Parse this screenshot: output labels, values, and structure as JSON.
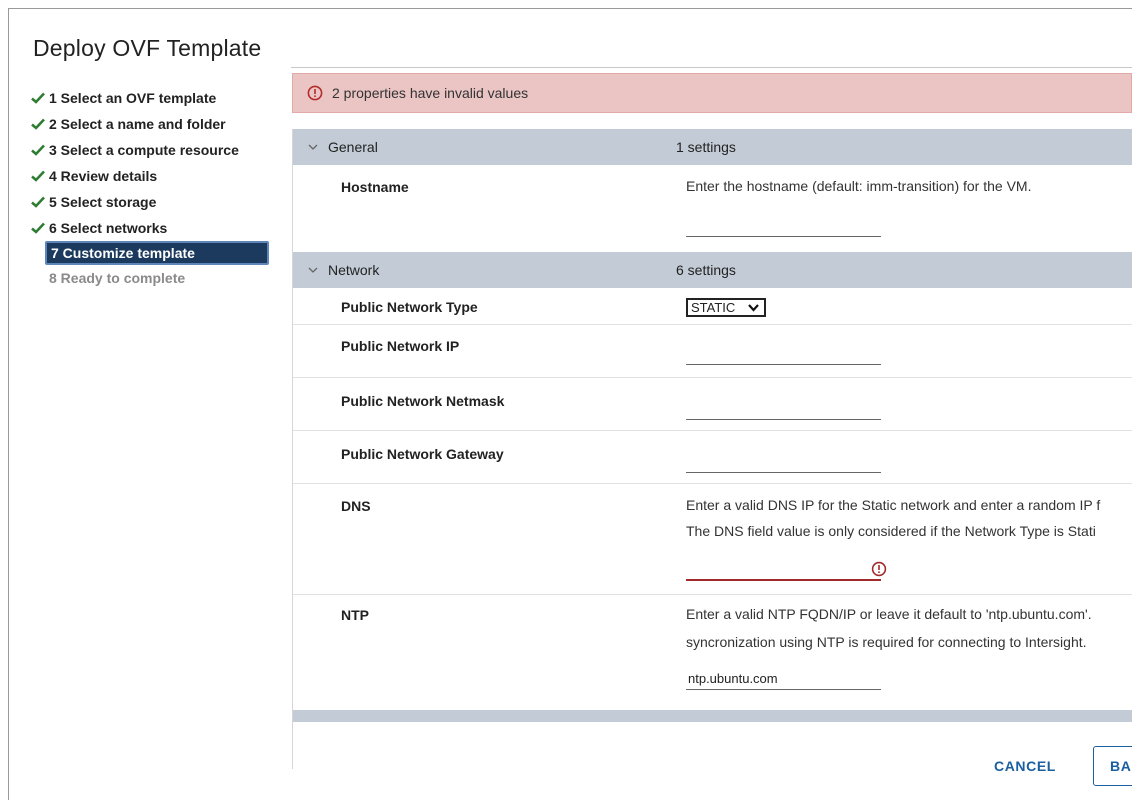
{
  "dialog": {
    "title": "Deploy OVF Template"
  },
  "steps": [
    {
      "label": "1 Select an OVF template",
      "state": "done"
    },
    {
      "label": "2 Select a name and folder",
      "state": "done"
    },
    {
      "label": "3 Select a compute resource",
      "state": "done"
    },
    {
      "label": "4 Review details",
      "state": "done"
    },
    {
      "label": "5 Select storage",
      "state": "done"
    },
    {
      "label": "6 Select networks",
      "state": "done"
    },
    {
      "label": "7 Customize template",
      "state": "active"
    },
    {
      "label": "8 Ready to complete",
      "state": "disabled"
    }
  ],
  "alert": {
    "text": "2 properties have invalid values",
    "icon": "error-circle-icon"
  },
  "general": {
    "name": "General",
    "count": "1 settings",
    "hostname": {
      "label": "Hostname",
      "description": "Enter the hostname (default: imm-transition) for the VM.",
      "value": ""
    }
  },
  "network": {
    "name": "Network",
    "count": "6 settings",
    "public_type": {
      "label": "Public Network Type",
      "value": "STATIC"
    },
    "public_ip": {
      "label": "Public Network IP",
      "value": ""
    },
    "public_netmask": {
      "label": "Public Network Netmask",
      "value": ""
    },
    "public_gateway": {
      "label": "Public Network Gateway",
      "value": ""
    },
    "dns": {
      "label": "DNS",
      "desc_line1": "Enter a valid DNS IP for the Static network and enter a random IP f",
      "desc_line2": "The DNS field value is only considered if the Network Type is Stati",
      "value": ""
    },
    "ntp": {
      "label": "NTP",
      "desc_line1": "Enter a valid NTP FQDN/IP or leave it default to 'ntp.ubuntu.com'. ",
      "desc_line2": "syncronization using NTP is required for connecting to Intersight.",
      "value": "ntp.ubuntu.com"
    }
  },
  "footer": {
    "cancel": "CANCEL",
    "back": "BAC"
  },
  "colors": {
    "accent": "#1a5fa0",
    "check": "#2e7d32",
    "error": "#a32a2a",
    "alert_bg": "#ebc4c4",
    "group_bg": "#c3ccd6",
    "active_step": "#1b3a5e"
  }
}
